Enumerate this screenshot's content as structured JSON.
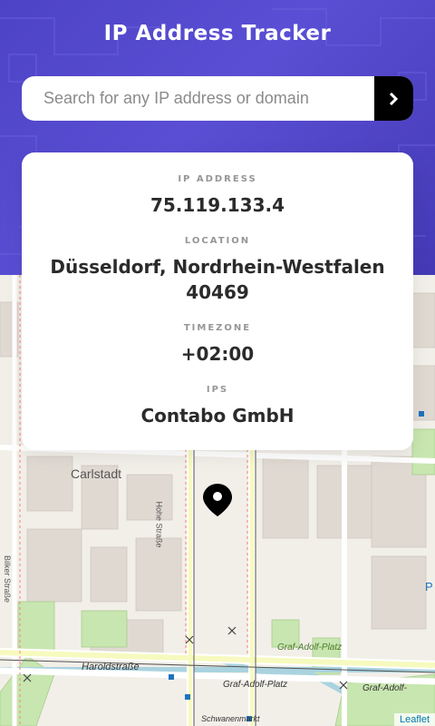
{
  "header": {
    "title": "IP Address Tracker",
    "search_placeholder": "Search for any IP address or domain",
    "search_value": ""
  },
  "info": {
    "ip_label": "IP ADDRESS",
    "ip_value": "75.119.133.4",
    "location_label": "LOCATION",
    "location_line1": "Düsseldorf, Nordrhein-Westfalen",
    "location_line2": "40469",
    "timezone_label": "TIMEZONE",
    "timezone_value": "+02:00",
    "isp_label": "IPS",
    "isp_value": "Contabo GmbH"
  },
  "map": {
    "labels": {
      "carlstadt": "Carlstadt",
      "haroldstrasse": "Haroldstraße",
      "graf_adolf_platz_1": "Graf-Adolf-Platz",
      "graf_adolf_platz_2": "Graf-Adolf-Platz",
      "graf_adolf_platz_3": "Graf-Adolf-",
      "schwanenmarkt": "Schwanenmarkt",
      "bilker_strasse": "Bilker Straße",
      "hohe_strasse": "Hohe Straße",
      "p": "P"
    },
    "attribution": "Leaflet"
  },
  "colors": {
    "header_bg": "#4d43c6",
    "button_bg": "#000000",
    "marker": "#000000"
  }
}
